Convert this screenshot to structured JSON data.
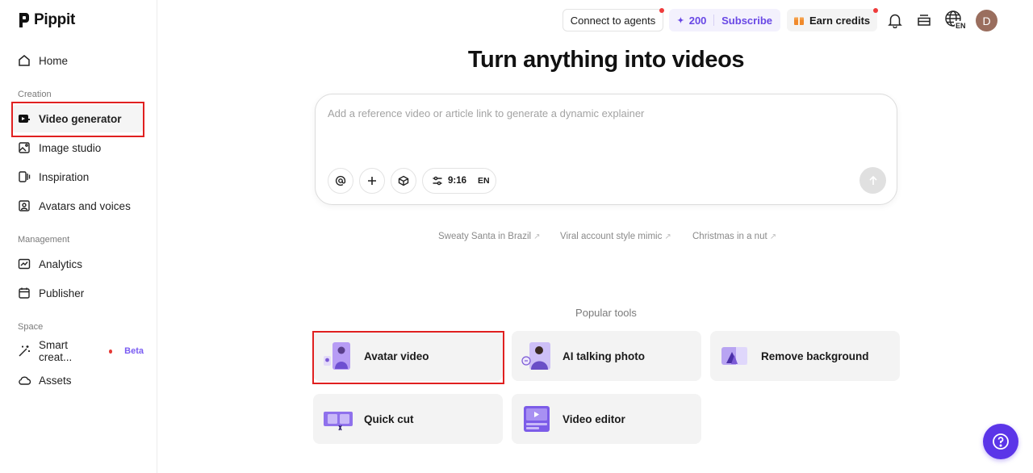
{
  "brand": {
    "name": "Pippit"
  },
  "sidebar": {
    "home": {
      "label": "Home",
      "icon": "home-icon"
    },
    "sections": {
      "creation": "Creation",
      "management": "Management",
      "space": "Space"
    },
    "creation_items": [
      {
        "label": "Video generator",
        "icon": "video-generator-icon",
        "active": true
      },
      {
        "label": "Image studio",
        "icon": "image-studio-icon"
      },
      {
        "label": "Inspiration",
        "icon": "inspiration-icon"
      },
      {
        "label": "Avatars and voices",
        "icon": "avatar-voice-icon"
      }
    ],
    "management_items": [
      {
        "label": "Analytics",
        "icon": "analytics-icon"
      },
      {
        "label": "Publisher",
        "icon": "calendar-icon"
      }
    ],
    "space_items": [
      {
        "label": "Smart creat...",
        "icon": "magic-wand-icon",
        "badge": "Beta"
      },
      {
        "label": "Assets",
        "icon": "cloud-icon"
      }
    ]
  },
  "topbar": {
    "connect_agents": "Connect to agents",
    "credits": "200",
    "subscribe": "Subscribe",
    "earn_credits": "Earn credits",
    "language_badge": "EN",
    "avatar_initial": "D"
  },
  "main": {
    "headline": "Turn anything into videos",
    "prompt_placeholder": "Add a reference video or article link to generate a dynamic explainer",
    "settings": {
      "ratio": "9:16",
      "language": "EN"
    },
    "suggestions": [
      "Sweaty Santa in Brazil",
      "Viral account style mimic",
      "Christmas in a nut"
    ],
    "popular_label": "Popular tools",
    "tools": [
      {
        "label": "Avatar video"
      },
      {
        "label": "AI talking photo"
      },
      {
        "label": "Remove background"
      },
      {
        "label": "Quick cut"
      },
      {
        "label": "Video editor"
      }
    ]
  },
  "colors": {
    "accent": "#6847e5",
    "help": "#5b35e8",
    "highlight": "#e02020"
  }
}
